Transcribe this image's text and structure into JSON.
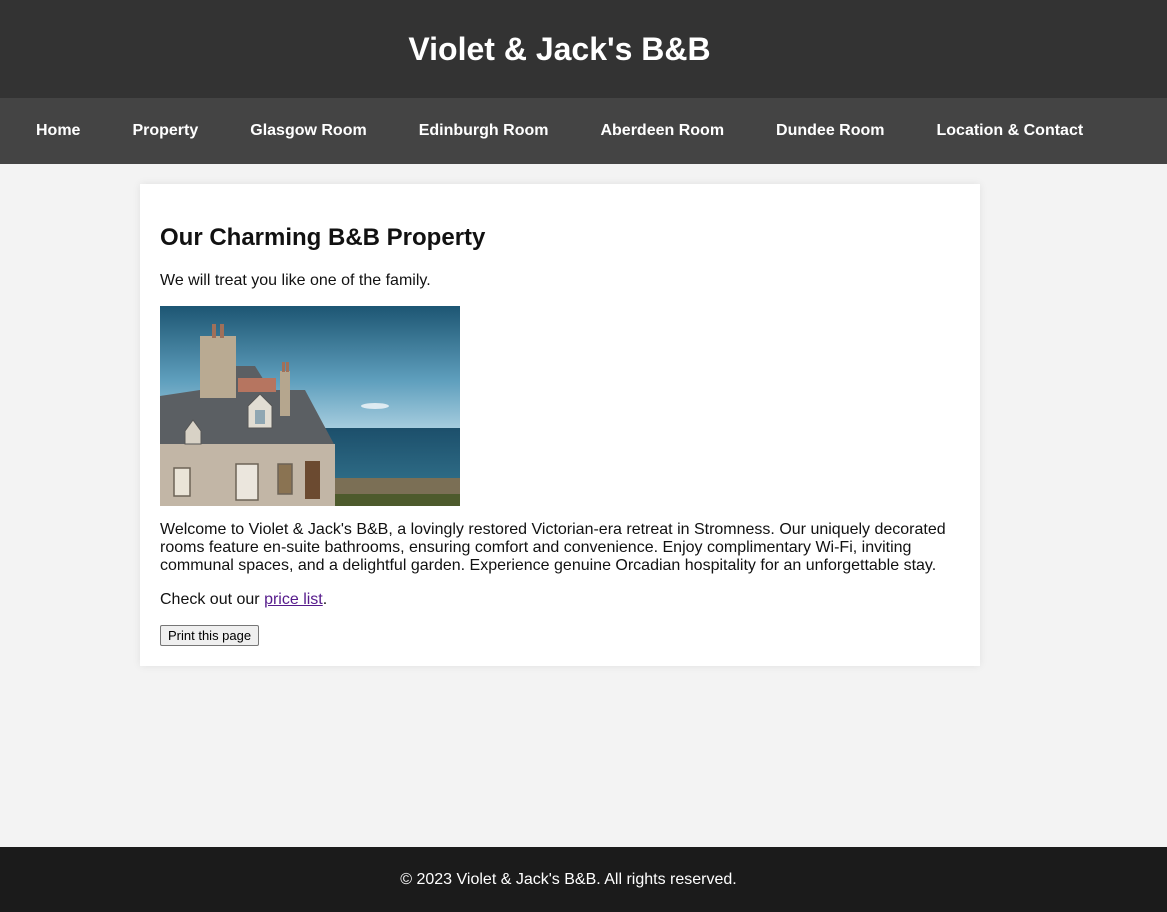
{
  "header": {
    "title": "Violet & Jack's B&B"
  },
  "nav": {
    "items": [
      {
        "label": "Home"
      },
      {
        "label": "Property"
      },
      {
        "label": "Glasgow Room"
      },
      {
        "label": "Edinburgh Room"
      },
      {
        "label": "Aberdeen Room"
      },
      {
        "label": "Dundee Room"
      },
      {
        "label": "Location & Contact"
      }
    ]
  },
  "main": {
    "heading": "Our Charming B&B Property",
    "tagline": "We will treat you like one of the family.",
    "image_alt": "Stone cottage by the sea",
    "description": "Welcome to Violet & Jack's B&B, a lovingly restored Victorian-era retreat in Stromness. Our uniquely decorated rooms feature en-suite bathrooms, ensuring comfort and convenience. Enjoy complimentary Wi-Fi, inviting communal spaces, and a delightful garden. Experience genuine Orcadian hospitality for an unforgettable stay.",
    "price_prefix": "Check out our ",
    "price_link": "price list",
    "price_suffix": ".",
    "print_button": "Print this page"
  },
  "footer": {
    "text": "© 2023 Violet & Jack's B&B. All rights reserved."
  },
  "colors": {
    "header_bg": "#333333",
    "nav_bg": "#444444",
    "page_bg": "#f3f3f3",
    "footer_bg": "#1b1b1b",
    "link_visited": "#551a8b"
  }
}
